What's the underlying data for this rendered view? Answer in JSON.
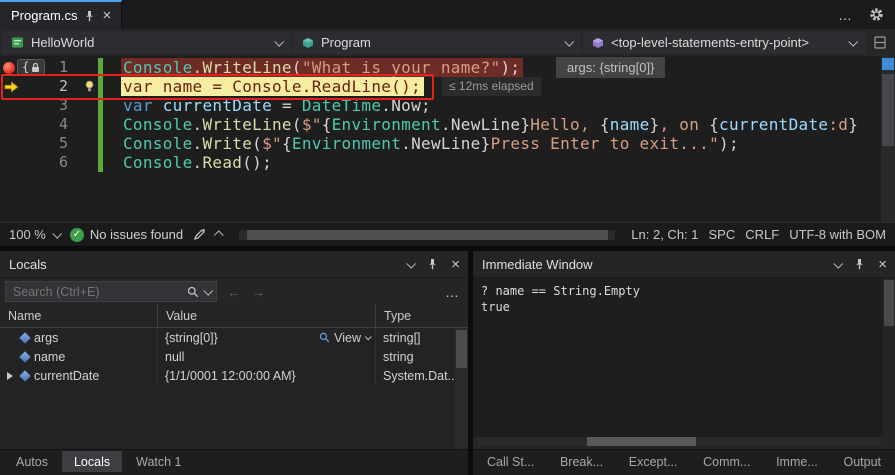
{
  "colors": {
    "accent_blue": "#4da2f0",
    "breakpoint_line_bg": "#6f2b26",
    "current_line_bg": "#f5eea2",
    "annotation_red": "#e0241b",
    "change_bar_green": "#5fa83c",
    "status_green": "#3f9e49",
    "token": {
      "cls": "#4EC9B0",
      "mth": "#DCDCAA",
      "kw": "#569CD6",
      "str": "#D69D85",
      "var": "#9CDCFE",
      "pln": "#D4D4D4",
      "drk": "#6a1e0d"
    }
  },
  "icons": {
    "close": "×",
    "more": "…",
    "back_arrow": "←",
    "forward_arrow": "→",
    "check": "✓"
  },
  "tab_bar": {
    "tab_label": "Program.cs"
  },
  "nav": {
    "project": "HelloWorld",
    "type": "Program",
    "member": "<top-level-statements-entry-point>"
  },
  "editor": {
    "lock_brace": "{",
    "datatip": "args: {string[0]}",
    "perftip": "≤ 12ms elapsed",
    "lines": [
      {
        "num": "1",
        "segs": [
          {
            "t": "Console",
            "c": "cls"
          },
          {
            "t": ".",
            "c": "pln"
          },
          {
            "t": "WriteLine",
            "c": "mth"
          },
          {
            "t": "(",
            "c": "pln"
          },
          {
            "t": "\"What is your name?\"",
            "c": "str"
          },
          {
            "t": ");",
            "c": "pln"
          }
        ]
      },
      {
        "num": "2",
        "segs": [
          {
            "t": "var name = Console.ReadLine();",
            "c": "drk"
          }
        ]
      },
      {
        "num": "3",
        "segs": [
          {
            "t": "var",
            "c": "kw"
          },
          {
            "t": " ",
            "c": "pln"
          },
          {
            "t": "currentDate",
            "c": "var"
          },
          {
            "t": " = ",
            "c": "pln"
          },
          {
            "t": "DateTime",
            "c": "cls"
          },
          {
            "t": ".",
            "c": "pln"
          },
          {
            "t": "Now",
            "c": "pln"
          },
          {
            "t": ";",
            "c": "pln"
          }
        ]
      },
      {
        "num": "4",
        "segs": [
          {
            "t": "Console",
            "c": "cls"
          },
          {
            "t": ".",
            "c": "pln"
          },
          {
            "t": "WriteLine",
            "c": "mth"
          },
          {
            "t": "(",
            "c": "pln"
          },
          {
            "t": "$\"",
            "c": "str"
          },
          {
            "t": "{",
            "c": "pln"
          },
          {
            "t": "Environment",
            "c": "cls"
          },
          {
            "t": ".NewLine",
            "c": "pln"
          },
          {
            "t": "}",
            "c": "pln"
          },
          {
            "t": "Hello, ",
            "c": "str"
          },
          {
            "t": "{",
            "c": "pln"
          },
          {
            "t": "name",
            "c": "var"
          },
          {
            "t": "}",
            "c": "pln"
          },
          {
            "t": ", on ",
            "c": "str"
          },
          {
            "t": "{",
            "c": "pln"
          },
          {
            "t": "currentDate",
            "c": "var"
          },
          {
            "t": ":d",
            "c": "str"
          },
          {
            "t": "}",
            "c": "pln"
          }
        ]
      },
      {
        "num": "5",
        "segs": [
          {
            "t": "Console",
            "c": "cls"
          },
          {
            "t": ".",
            "c": "pln"
          },
          {
            "t": "Write",
            "c": "mth"
          },
          {
            "t": "(",
            "c": "pln"
          },
          {
            "t": "$\"",
            "c": "str"
          },
          {
            "t": "{",
            "c": "pln"
          },
          {
            "t": "Environment",
            "c": "cls"
          },
          {
            "t": ".NewLine",
            "c": "pln"
          },
          {
            "t": "}",
            "c": "pln"
          },
          {
            "t": "Press Enter to exit...\"",
            "c": "str"
          },
          {
            "t": ");",
            "c": "pln"
          }
        ]
      },
      {
        "num": "6",
        "segs": [
          {
            "t": "Console",
            "c": "cls"
          },
          {
            "t": ".",
            "c": "pln"
          },
          {
            "t": "Read",
            "c": "mth"
          },
          {
            "t": "();",
            "c": "pln"
          }
        ]
      }
    ]
  },
  "status": {
    "zoom": "100 %",
    "issues": "No issues found",
    "position": "Ln: 2, Ch: 1",
    "spaces": "SPC",
    "line_ending": "CRLF",
    "encoding": "UTF-8 with BOM"
  },
  "locals": {
    "title": "Locals",
    "search_placeholder": "Search (Ctrl+E)",
    "columns": [
      "Name",
      "Value",
      "Type"
    ],
    "rows": [
      {
        "name": "args",
        "value": "{string[0]}",
        "view_label": "View",
        "type": "string[]"
      },
      {
        "name": "name",
        "value": "null",
        "type": "string"
      },
      {
        "name": "currentDate",
        "value": "{1/1/0001 12:00:00 AM}",
        "type": "System.Dat..."
      }
    ],
    "tabs": [
      "Autos",
      "Locals",
      "Watch 1"
    ]
  },
  "immediate": {
    "title": "Immediate Window",
    "lines": [
      "? name == String.Empty",
      "true"
    ],
    "tabs": [
      "Call St...",
      "Break...",
      "Except...",
      "Comm...",
      "Imme...",
      "Output"
    ]
  }
}
